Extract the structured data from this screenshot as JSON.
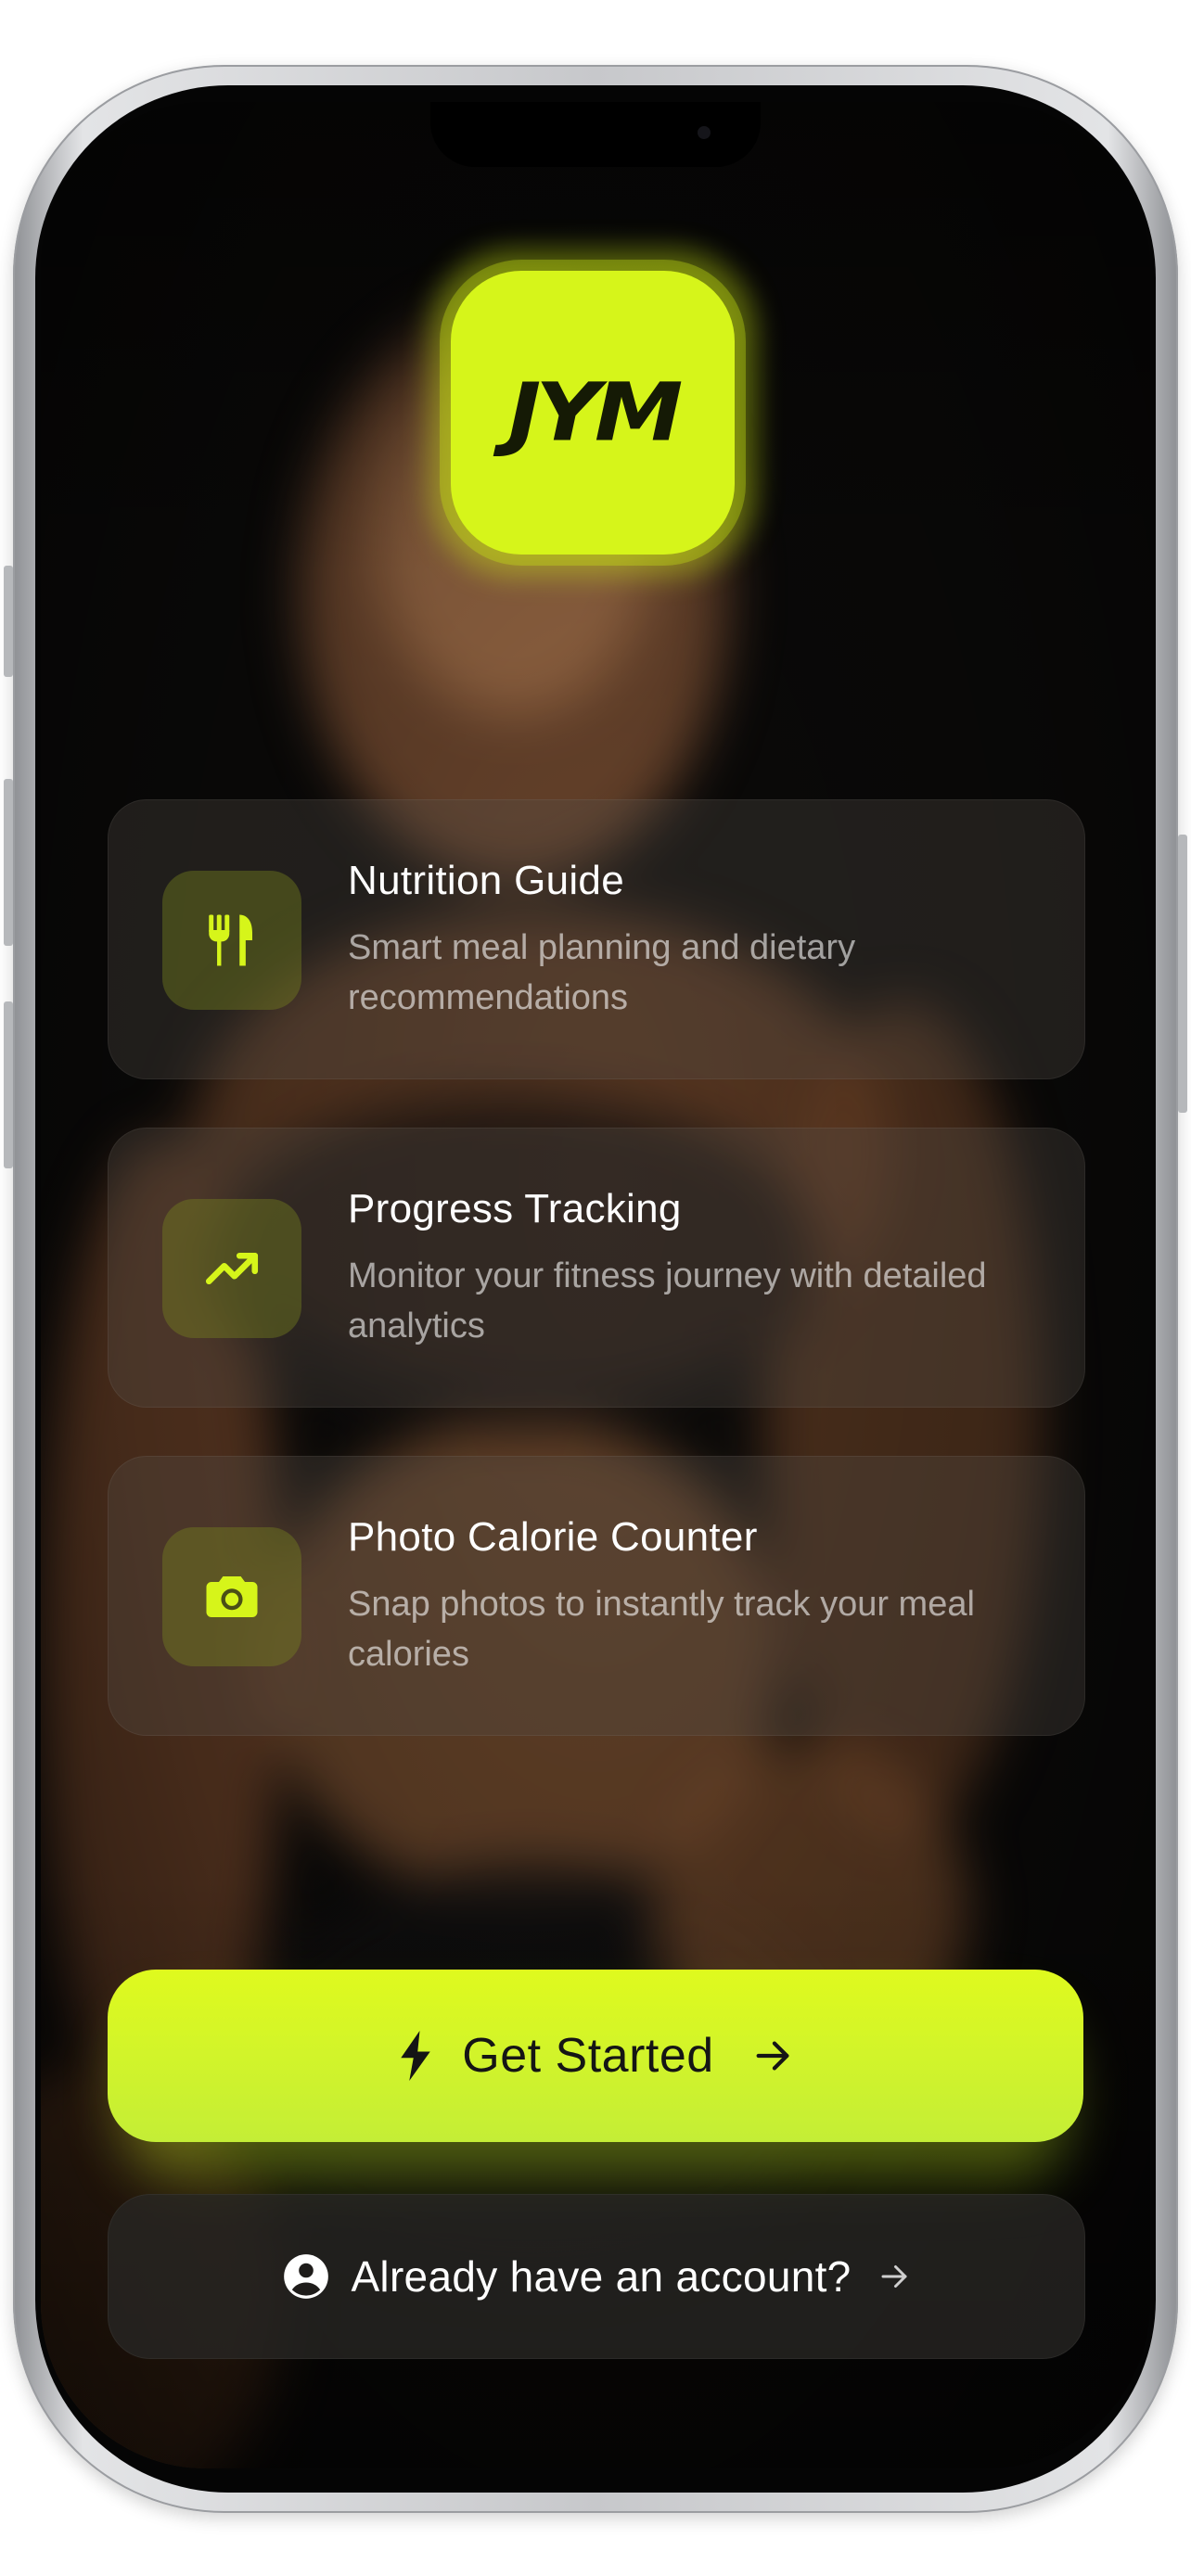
{
  "app": {
    "logo_text": "JYM"
  },
  "features": [
    {
      "icon": "utensils-icon",
      "title": "Nutrition Guide",
      "description": "Smart meal planning and dietary recommendations"
    },
    {
      "icon": "trending-up-icon",
      "title": "Progress Tracking",
      "description": "Monitor your fitness journey with detailed analytics"
    },
    {
      "icon": "camera-icon",
      "title": "Photo Calorie Counter",
      "description": "Snap photos to instantly track your meal calories"
    }
  ],
  "actions": {
    "primary_label": "Get Started",
    "primary_icon": "bolt-icon",
    "secondary_label": "Already have an account?",
    "secondary_icon": "user-circle-icon"
  },
  "colors": {
    "accent": "#d6f51a",
    "background": "#0b0a09",
    "card": "#3a3530"
  }
}
